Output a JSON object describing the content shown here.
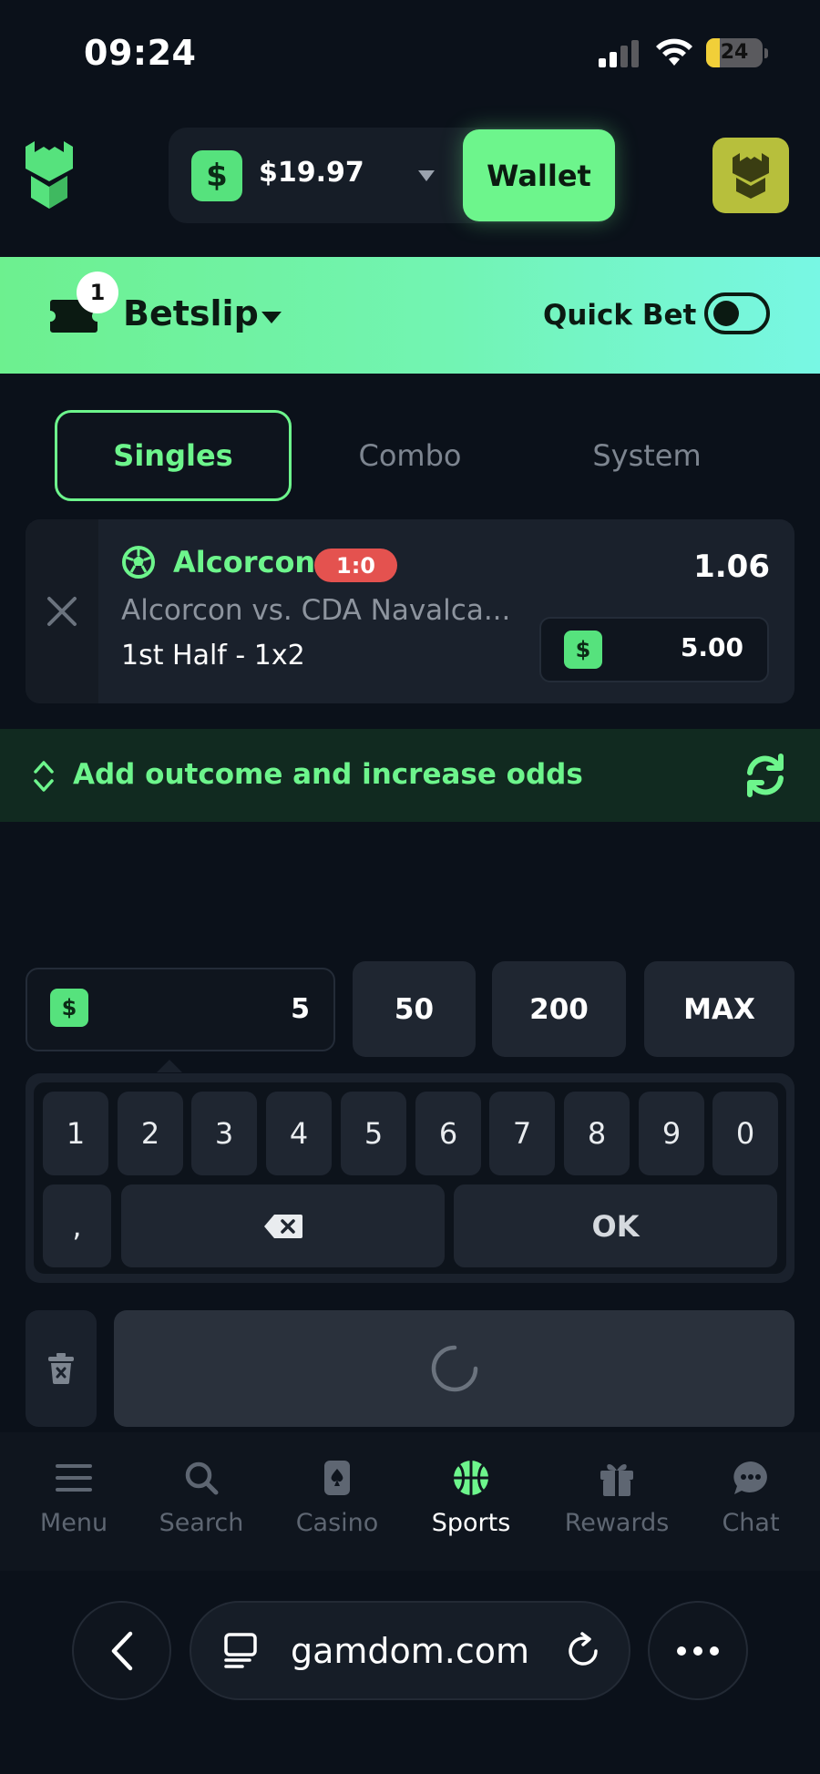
{
  "status_bar": {
    "time": "09:24",
    "battery": "24",
    "battery_level": 0.24
  },
  "header": {
    "balance_currency_icon": "$",
    "balance": "$19.97",
    "wallet_label": "Wallet"
  },
  "betslip": {
    "count": "1",
    "title": "Betslip",
    "quick_bet_label": "Quick Bet",
    "quick_bet_enabled": false
  },
  "tabs": [
    {
      "label": "Singles",
      "active": true
    },
    {
      "label": "Combo",
      "active": false
    },
    {
      "label": "System",
      "active": false
    }
  ],
  "bet": {
    "team": "Alcorcon",
    "score": "1:0",
    "match": "Alcorcon vs. CDA Navalca...",
    "market": "1st Half - 1x2",
    "odds": "1.06",
    "stake_currency": "$",
    "stake": "5.00"
  },
  "add_outcome": {
    "label": "Add outcome and increase odds"
  },
  "amount": {
    "currency": "$",
    "value": "5",
    "quick_options": [
      "50",
      "200",
      "MAX"
    ]
  },
  "keypad": {
    "digits": [
      "1",
      "2",
      "3",
      "4",
      "5",
      "6",
      "7",
      "8",
      "9",
      "0"
    ],
    "comma": ",",
    "ok": "OK"
  },
  "bottom_nav": [
    {
      "label": "Menu",
      "icon": "menu-icon",
      "active": false
    },
    {
      "label": "Search",
      "icon": "search-icon",
      "active": false
    },
    {
      "label": "Casino",
      "icon": "casino-icon",
      "active": false
    },
    {
      "label": "Sports",
      "icon": "sports-icon",
      "active": true
    },
    {
      "label": "Rewards",
      "icon": "gift-icon",
      "active": false
    },
    {
      "label": "Chat",
      "icon": "chat-icon",
      "active": false
    }
  ],
  "browser": {
    "url": "gamdom.com"
  },
  "colors": {
    "accent": "#6df58c",
    "background": "#0b111a",
    "score_badge": "#e4524f",
    "avatar": "#b7bf3c"
  }
}
